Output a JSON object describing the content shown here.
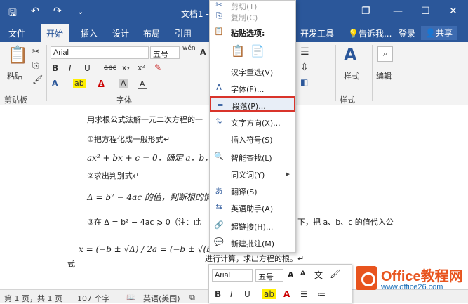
{
  "window": {
    "title": "文档1 -",
    "save_icon": "🖫",
    "undo_icon": "↶",
    "redo_icon": "↷",
    "qat_more": "⌄",
    "restore_icon": "❐",
    "minimize_icon": "—",
    "maximize_icon": "☐",
    "close_icon": "✕"
  },
  "tabs": [
    "文件",
    "开始",
    "插入",
    "设计",
    "布局",
    "引用"
  ],
  "right_tabs": {
    "developer": "开发工具",
    "tell_me": "告诉我...",
    "login": "登录",
    "share": "共享"
  },
  "ribbon": {
    "clipboard_label": "剪贴板",
    "paste_label": "粘贴",
    "font_name": "Arial",
    "font_size": "五号",
    "wen": "wén",
    "font_group_label": "字体",
    "style_label": "样式",
    "edit_label": "编辑",
    "styles_group_label": "样式",
    "bold": "B",
    "italic": "I",
    "underline": "U",
    "strike": "abc",
    "sub": "x₂",
    "sup": "x²",
    "grow": "A",
    "shrink": "A"
  },
  "context_menu": {
    "items": [
      {
        "icon": "✂",
        "label": "剪切(T)"
      },
      {
        "icon": "⎘",
        "label": "复制(C)"
      },
      {
        "icon": "📋",
        "label": "粘贴选项:"
      },
      {
        "icon": "",
        "label": ""
      },
      {
        "icon": "",
        "label": "汉字重选(V)"
      },
      {
        "icon": "A",
        "label": "字体(F)..."
      },
      {
        "icon": "≡",
        "label": "段落(P)..."
      },
      {
        "icon": "⇅",
        "label": "文字方向(X)..."
      },
      {
        "icon": "",
        "label": "插入符号(S)"
      },
      {
        "icon": "🔍",
        "label": "智能查找(L)"
      },
      {
        "icon": "",
        "label": "同义词(Y)"
      },
      {
        "icon": "あ",
        "label": "翻译(S)"
      },
      {
        "icon": "⇆",
        "label": "英语助手(A)"
      },
      {
        "icon": "🔗",
        "label": "超链接(H)..."
      },
      {
        "icon": "💬",
        "label": "新建批注(M)"
      }
    ]
  },
  "document": {
    "line1": "用求根公式法解一元二次方程的一",
    "line2": "①把方程化成一般形式↵",
    "line3_math": "ax² + bx + c = 0，确定 a，b，",
    "line4": "②求出判别式↵",
    "line5_math": "Δ = b² − 4ac 的值，判断根的情况",
    "line6_a": "③在 Δ = b² − 4ac ⩾ 0（注：此",
    "line6_b": "下，把 a、b、c 的值代入公",
    "line7_label": "式",
    "line7_math": "x = (−b ± √Δ) / 2a = (−b ± √(b² − 4ac)) / 2a",
    "line7_tail": "进行计算，求出方程的根。↵"
  },
  "mini_toolbar": {
    "font": "Arial",
    "size": "五号",
    "bold": "B",
    "italic": "I",
    "underline": "U"
  },
  "status": {
    "page": "第 1 页，共 1 页",
    "words": "107 个字",
    "lang": "英语(美国)"
  },
  "watermark": {
    "brand": "Office教程网",
    "url": "www.office26.com"
  }
}
